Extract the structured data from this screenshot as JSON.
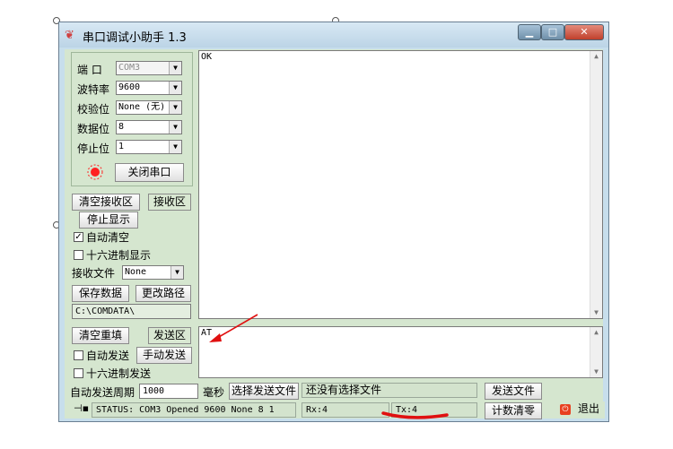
{
  "window": {
    "title": "串口调试小助手 1.3",
    "minimize": "▁",
    "maximize": "□",
    "close": "✕"
  },
  "settings": {
    "port_label": "端  口",
    "port_value": "COM3",
    "baud_label": "波特率",
    "baud_value": "9600",
    "parity_label": "校验位",
    "parity_value": "None (无)",
    "databits_label": "数据位",
    "databits_value": "8",
    "stopbits_label": "停止位",
    "stopbits_value": "1",
    "open_close_button": "关闭串口"
  },
  "receive": {
    "clear_button": "清空接收区",
    "area_button": "接收区",
    "stop_display_button": "停止显示",
    "auto_clear_label": "自动清空",
    "auto_clear_checked": "✓",
    "hex_display_label": "十六进制显示",
    "file_label": "接收文件",
    "file_value": "None",
    "save_button": "保存数据",
    "change_path_button": "更改路径",
    "path": "C:\\COMDATA\\",
    "content": "OK"
  },
  "send": {
    "clear_button": "清空重填",
    "area_button": "发送区",
    "auto_send_label": "自动发送",
    "manual_send_button": "手动发送",
    "hex_send_label": "十六进制发送",
    "period_label": "自动发送周期",
    "period_value": "1000",
    "ms_label": "毫秒",
    "select_file_button": "选择发送文件",
    "file_status": "还没有选择文件",
    "send_file_button": "发送文件",
    "content": "AT"
  },
  "statusbar": {
    "status": "STATUS: COM3 Opened 9600 None  8 1",
    "rx": "Rx:4",
    "tx": "Tx:4",
    "reset_count_button": "计数清零",
    "exit_button": "退出"
  },
  "colors": {
    "annotation_red": "#e01010",
    "indicator_red": "#ff2020",
    "panel_green": "#d5e6cf"
  }
}
